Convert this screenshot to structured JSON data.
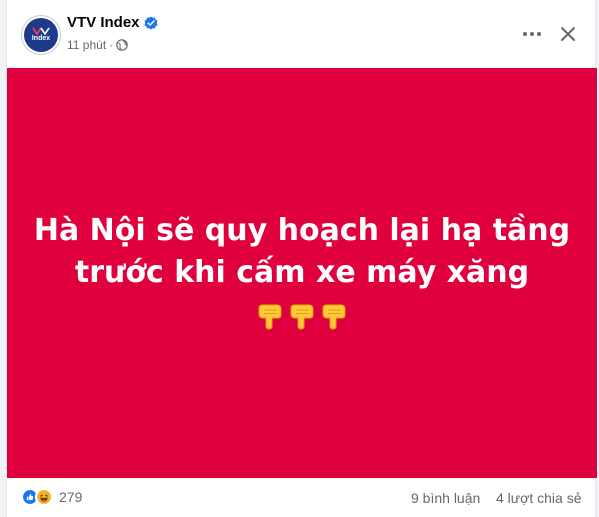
{
  "post": {
    "author": "VTV Index",
    "avatar_label": "Index",
    "time": "11 phút",
    "dot": "·",
    "headline_line1": "Hà Nội sẽ quy hoạch lại hạ tầng",
    "headline_line2": "trước khi cấm xe máy xăng",
    "emoji": [
      "pointing-down-emoji",
      "pointing-down-emoji",
      "pointing-down-emoji"
    ]
  },
  "footer": {
    "reaction_count": "279",
    "comments": "9 bình luận",
    "shares": "4 lượt chia sẻ"
  },
  "colors": {
    "image_bg": "#e0003e",
    "verified": "#1877f2",
    "like": "#1877f2",
    "haha": "#f7b125",
    "muted_text": "#65676b"
  },
  "icons": {
    "verified": "verified-badge-icon",
    "globe": "globe-icon",
    "more": "more-options-icon",
    "close": "close-icon",
    "like": "like-reaction-icon",
    "haha": "haha-reaction-icon"
  }
}
